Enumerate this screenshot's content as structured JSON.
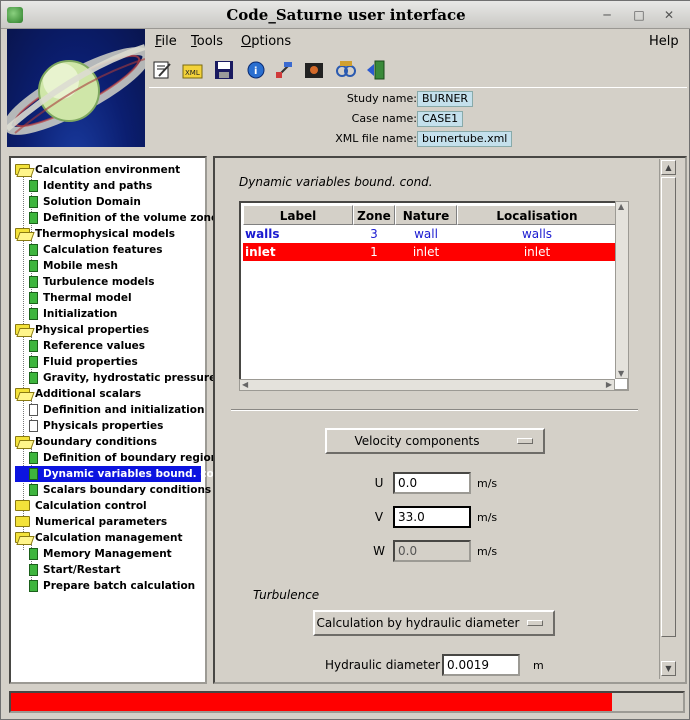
{
  "window": {
    "title": "Code_Saturne user interface",
    "controls": [
      "minimize-icon",
      "maximize-icon",
      "close-icon"
    ]
  },
  "menu": {
    "file": "File",
    "tools": "Tools",
    "options": "Options",
    "help": "Help"
  },
  "toolbar": {
    "icons": [
      "edit-icon",
      "open-xml-icon",
      "save-icon",
      "info-icon",
      "satellite-icon",
      "screenshot-icon",
      "identity-icon",
      "exit-icon"
    ]
  },
  "study": {
    "study_label": "Study name:",
    "study_value": "BURNER",
    "case_label": "Case name:",
    "case_value": "CASE1",
    "xml_label": "XML file name:",
    "xml_value": "burnertube.xml"
  },
  "tree": {
    "calc_env": "Calculation environment",
    "identity": "Identity and paths",
    "solution": "Solution Domain",
    "volume_zones": "Definition of the volume zones",
    "thermo": "Thermophysical models",
    "calc_features": "Calculation features",
    "mobile_mesh": "Mobile mesh",
    "turbulence": "Turbulence models",
    "thermal": "Thermal model",
    "init": "Initialization",
    "phys_props": "Physical properties",
    "ref_values": "Reference values",
    "fluid_props": "Fluid properties",
    "gravity": "Gravity, hydrostatic pressure",
    "add_scalars": "Additional scalars",
    "def_init": "Definition and initialization",
    "physicals_props": "Physicals properties",
    "bc": "Boundary conditions",
    "def_bc": "Definition of boundary regions",
    "dyn_vars": "Dynamic variables bound. cond.",
    "scalars_bc": "Scalars boundary conditions",
    "calc_control": "Calculation control",
    "numerical": "Numerical parameters",
    "calc_mgmt": "Calculation management",
    "memory": "Memory Management",
    "start_restart": "Start/Restart",
    "batch": "Prepare batch calculation"
  },
  "main": {
    "section_title": "Dynamic variables bound. cond.",
    "table": {
      "headers": [
        "Label",
        "Zone",
        "Nature",
        "Localisation"
      ],
      "rows": [
        {
          "label": "walls",
          "zone": "3",
          "nature": "wall",
          "localisation": "walls"
        },
        {
          "label": "inlet",
          "zone": "1",
          "nature": "inlet",
          "localisation": "inlet"
        }
      ]
    },
    "velocity_combo": "Velocity components",
    "u_label": "U",
    "u_value": "0.0",
    "u_unit": "m/s",
    "v_label": "V",
    "v_value": "33.0",
    "v_unit": "m/s",
    "w_label": "W",
    "w_value": "0.0",
    "w_unit": "m/s",
    "turbulence_title": "Turbulence",
    "turbulence_combo": "Calculation by hydraulic diameter",
    "hd_label": "Hydraulic diameter",
    "hd_value": "0.0019",
    "hd_unit": "m"
  },
  "status": {
    "progress": 0.895,
    "color": "#ff0000"
  }
}
